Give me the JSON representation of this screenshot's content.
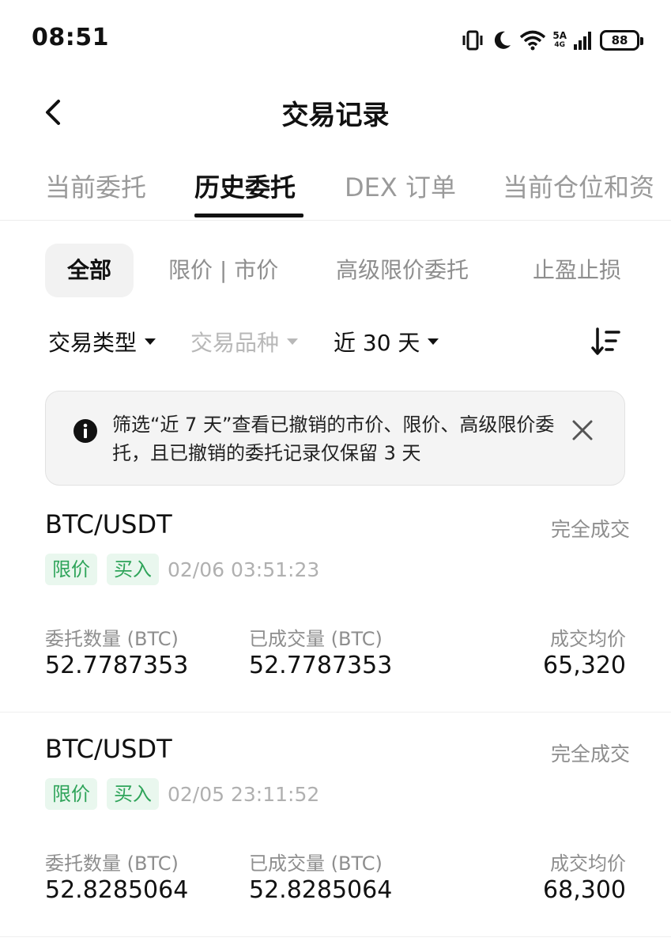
{
  "status_bar": {
    "time": "08:51",
    "network_label_top": "5A",
    "network_label_bottom": "4G",
    "battery_level": "88"
  },
  "header": {
    "title": "交易记录"
  },
  "tabs": [
    {
      "label": "当前委托"
    },
    {
      "label": "历史委托"
    },
    {
      "label": "DEX 订单"
    },
    {
      "label": "当前仓位和资"
    }
  ],
  "subtabs": [
    {
      "label": "全部"
    },
    {
      "label": "限价 | 市价"
    },
    {
      "label": "高级限价委托"
    },
    {
      "label": "止盈止损"
    }
  ],
  "filters": {
    "trade_type": "交易类型",
    "instrument": "交易品种",
    "period": "近 30 天"
  },
  "notice": {
    "text": "筛选“近 7 天”查看已撤销的市价、限价、高级限价委托，且已撤销的委托记录仅保留 3 天"
  },
  "orders": [
    {
      "pair": "BTC/USDT",
      "status": "完全成交",
      "order_type": "限价",
      "side": "买入",
      "time": "02/06 03:51:23",
      "labels": {
        "amount": "委托数量 (BTC)",
        "filled": "已成交量 (BTC)",
        "avg": "成交均价"
      },
      "amount": "52.7787353",
      "filled": "52.7787353",
      "avg_price": "65,320"
    },
    {
      "pair": "BTC/USDT",
      "status": "完全成交",
      "order_type": "限价",
      "side": "买入",
      "time": "02/05 23:11:52",
      "labels": {
        "amount": "委托数量 (BTC)",
        "filled": "已成交量 (BTC)",
        "avg": "成交均价"
      },
      "amount": "52.8285064",
      "filled": "52.8285064",
      "avg_price": "68,300"
    }
  ],
  "colors": {
    "accent_green": "#2fa45a",
    "badge_bg": "#e9f7ee",
    "muted_text": "#8e8e8e",
    "primary_text": "#111111"
  },
  "icons": {
    "back": "chevron-left-icon",
    "vibrate": "vibrate-icon",
    "moon": "moon-icon",
    "wifi": "wifi-icon",
    "signal": "signal-icon",
    "info": "info-icon",
    "close": "close-icon",
    "sort": "sort-icon"
  }
}
